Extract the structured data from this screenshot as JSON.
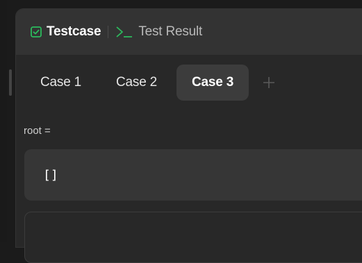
{
  "header": {
    "testcase_label": "Testcase",
    "result_label": "Test Result"
  },
  "cases": {
    "tabs": [
      {
        "label": "Case 1",
        "active": false
      },
      {
        "label": "Case 2",
        "active": false
      },
      {
        "label": "Case 3",
        "active": true
      }
    ],
    "add_icon": "plus-icon"
  },
  "input": {
    "var_label": "root =",
    "value": "[]"
  },
  "colors": {
    "check_green": "#2cbb5d",
    "terminal_green": "#2cbb5d"
  }
}
